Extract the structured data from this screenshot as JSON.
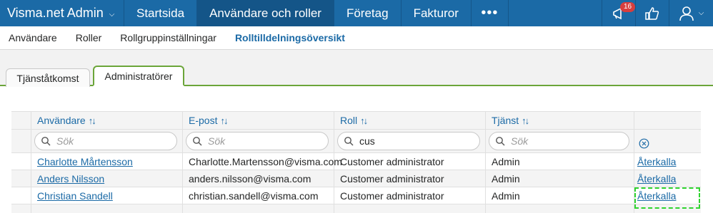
{
  "topbar": {
    "brand": "Visma.net Admin",
    "nav": [
      "Startsida",
      "Användare och roller",
      "Företag",
      "Fakturor"
    ],
    "active_nav": 1,
    "more": "•••",
    "notification_count": "16"
  },
  "subnav": {
    "items": [
      "Användare",
      "Roller",
      "Rollgruppinställningar",
      "Rolltilldelningsöversikt"
    ],
    "active": 3
  },
  "tabs": [
    "Tjänståtkomst",
    "Administratörer"
  ],
  "grid": {
    "columns": [
      "Användare",
      "E-post",
      "Roll",
      "Tjänst"
    ],
    "sort_glyph": "↑↓",
    "filters": [
      {
        "placeholder": "Sök",
        "value": ""
      },
      {
        "placeholder": "Sök",
        "value": ""
      },
      {
        "placeholder": "Sök",
        "value": "cus"
      },
      {
        "placeholder": "Sök",
        "value": ""
      }
    ],
    "rows": [
      {
        "user": "Charlotte Mårtensson",
        "email": "Charlotte.Martensson@visma.com",
        "role": "Customer administrator",
        "service": "Admin",
        "action": "Återkalla"
      },
      {
        "user": "Anders Nilsson",
        "email": "anders.nilsson@visma.com",
        "role": "Customer administrator",
        "service": "Admin",
        "action": "Återkalla"
      },
      {
        "user": "Christian Sandell",
        "email": "christian.sandell@visma.com",
        "role": "Customer administrator",
        "service": "Admin",
        "action": "Återkalla"
      }
    ]
  },
  "colors": {
    "primary": "#1b6aa6",
    "accent_green": "#6ba539",
    "highlight": "#2fd42f"
  }
}
